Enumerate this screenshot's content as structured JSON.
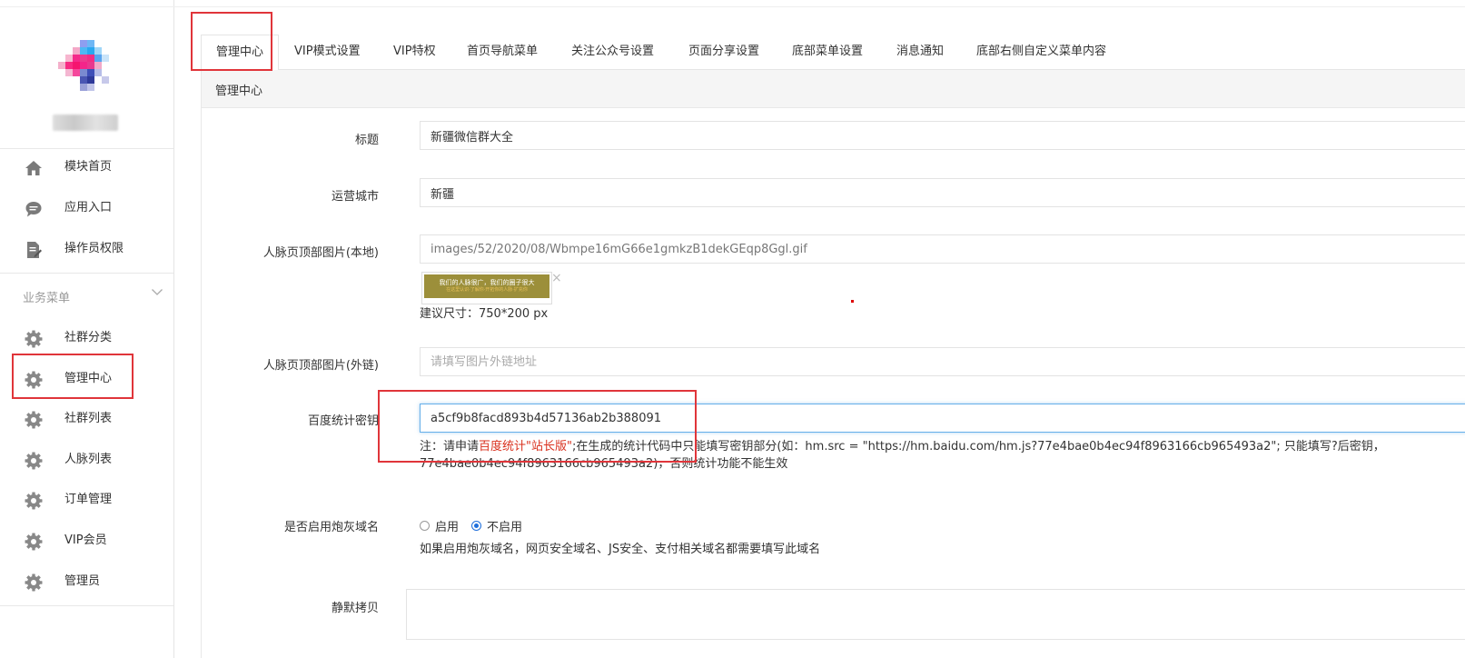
{
  "sidebar": {
    "items_top": [
      {
        "label": "模块首页",
        "icon": "home-icon"
      },
      {
        "label": "应用入口",
        "icon": "chat-icon"
      },
      {
        "label": "操作员权限",
        "icon": "document-edit-icon"
      }
    ],
    "section_title": "业务菜单",
    "items_business": [
      {
        "label": "社群分类",
        "icon": "gear-icon"
      },
      {
        "label": "管理中心",
        "icon": "gear-icon"
      },
      {
        "label": "社群列表",
        "icon": "gear-icon"
      },
      {
        "label": "人脉列表",
        "icon": "gear-icon"
      },
      {
        "label": "订单管理",
        "icon": "gear-icon"
      },
      {
        "label": "VIP会员",
        "icon": "gear-icon"
      },
      {
        "label": "管理员",
        "icon": "gear-icon"
      }
    ]
  },
  "tabs": [
    {
      "label": "管理中心"
    },
    {
      "label": "VIP模式设置"
    },
    {
      "label": "VIP特权"
    },
    {
      "label": "首页导航菜单"
    },
    {
      "label": "关注公众号设置"
    },
    {
      "label": "页面分享设置"
    },
    {
      "label": "底部菜单设置"
    },
    {
      "label": "消息通知"
    },
    {
      "label": "底部右侧自定义菜单内容"
    }
  ],
  "panel": {
    "heading": "管理中心"
  },
  "form": {
    "title_label": "标题",
    "title_value": "新疆微信群大全",
    "city_label": "运营城市",
    "city_value": "新疆",
    "local_image_label": "人脉页顶部图片(本地)",
    "local_image_value": "images/52/2020/08/Wbmpe16mG66e1gmkzB1dekGEqp8Ggl.gif",
    "thumb_line1": "我们的人脉很广，我们的圈子很大",
    "thumb_line2": "在这里认识·了解你·开拓你的人脉·扩充你",
    "thumb_remove": "×",
    "size_hint": "建议尺寸：750*200 px",
    "external_image_label": "人脉页顶部图片(外链)",
    "external_image_placeholder": "请填写图片外链地址",
    "baidu_label": "百度统计密钥",
    "baidu_value": "a5cf9b8facd893b4d57136ab2b388091",
    "note_prefix": "注：请申请",
    "note_red": "百度统计\"站长版\"",
    "note_suffix": ";在生成的统计代码中只能填写密钥部分(如：hm.src = \"https://hm.baidu.com/hm.js?77e4bae0b4ec94f8963166cb965493a2\"; 只能填写?后密钥，77e4bae0b4ec94f8963166cb965493a2)，否则统计功能不能生效",
    "cannon_label": "是否启用炮灰域名",
    "radio_enable": "启用",
    "radio_disable": "不启用",
    "cannon_help": "如果启用炮灰域名，网页安全域名、JS安全、支付相关域名都需要填写此域名",
    "silent_copy_label": "静默拷贝"
  },
  "colors": {
    "highlight": "#e0353a",
    "note_red": "#d9311e",
    "radio_blue": "#1e6fdc",
    "focus_border": "#66afe9"
  }
}
